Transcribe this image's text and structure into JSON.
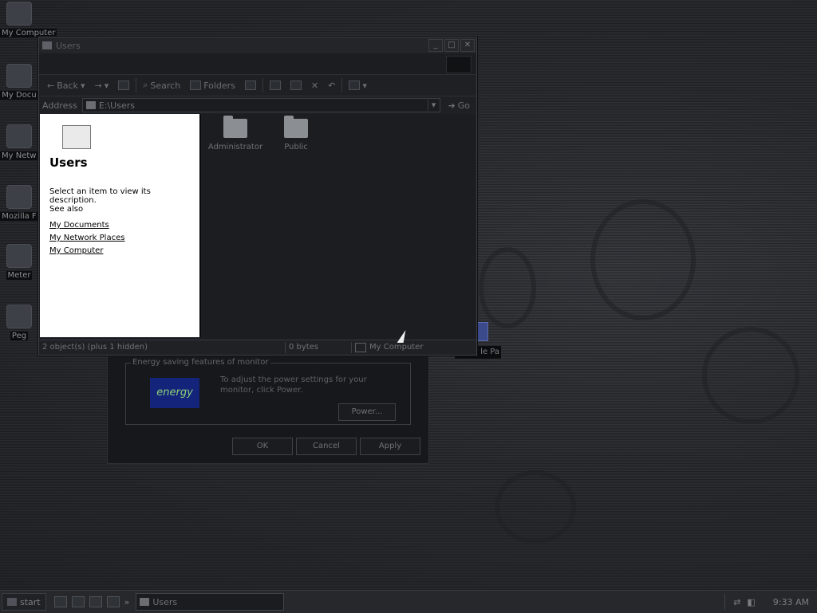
{
  "desktop_icons": [
    {
      "label": "My Computer",
      "icon": "computer-icon"
    },
    {
      "label": "My Docu",
      "icon": "documents-icon"
    },
    {
      "label": "My Netw Plac",
      "icon": "network-icon"
    },
    {
      "label": "Mozilla F",
      "icon": "browser-icon"
    },
    {
      "label": "Meter",
      "icon": "shortcut-icon"
    },
    {
      "label": "Peg",
      "icon": "shortcut-icon"
    }
  ],
  "window": {
    "title": "Users",
    "toolbar": {
      "back": "Back",
      "search": "Search",
      "folders": "Folders"
    },
    "address_label": "Address",
    "address_value": "E:\\Users",
    "go_label": "Go",
    "tasks": {
      "header": "Users",
      "subtitle": "Select an item to view its description.",
      "see_also": "See also",
      "links": [
        "My Documents",
        "My Network Places",
        "My Computer"
      ]
    },
    "files": [
      {
        "name": "Administrator",
        "icon": "folder-icon"
      },
      {
        "name": "Public",
        "icon": "folder-icon"
      }
    ],
    "status": {
      "objects": "2 object(s) (plus 1 hidden)",
      "size": "0 bytes",
      "location": "My Computer"
    }
  },
  "dialog": {
    "group_label": "Energy saving features of monitor",
    "logo_text": "energy",
    "description": "To adjust the power settings for your monitor, click Power.",
    "power_button": "Power...",
    "ok": "OK",
    "cancel": "Cancel",
    "apply": "Apply"
  },
  "hidden_window_tab": "le Pa",
  "taskbar": {
    "start": "start",
    "task": "Users",
    "clock": "9:33 AM"
  }
}
